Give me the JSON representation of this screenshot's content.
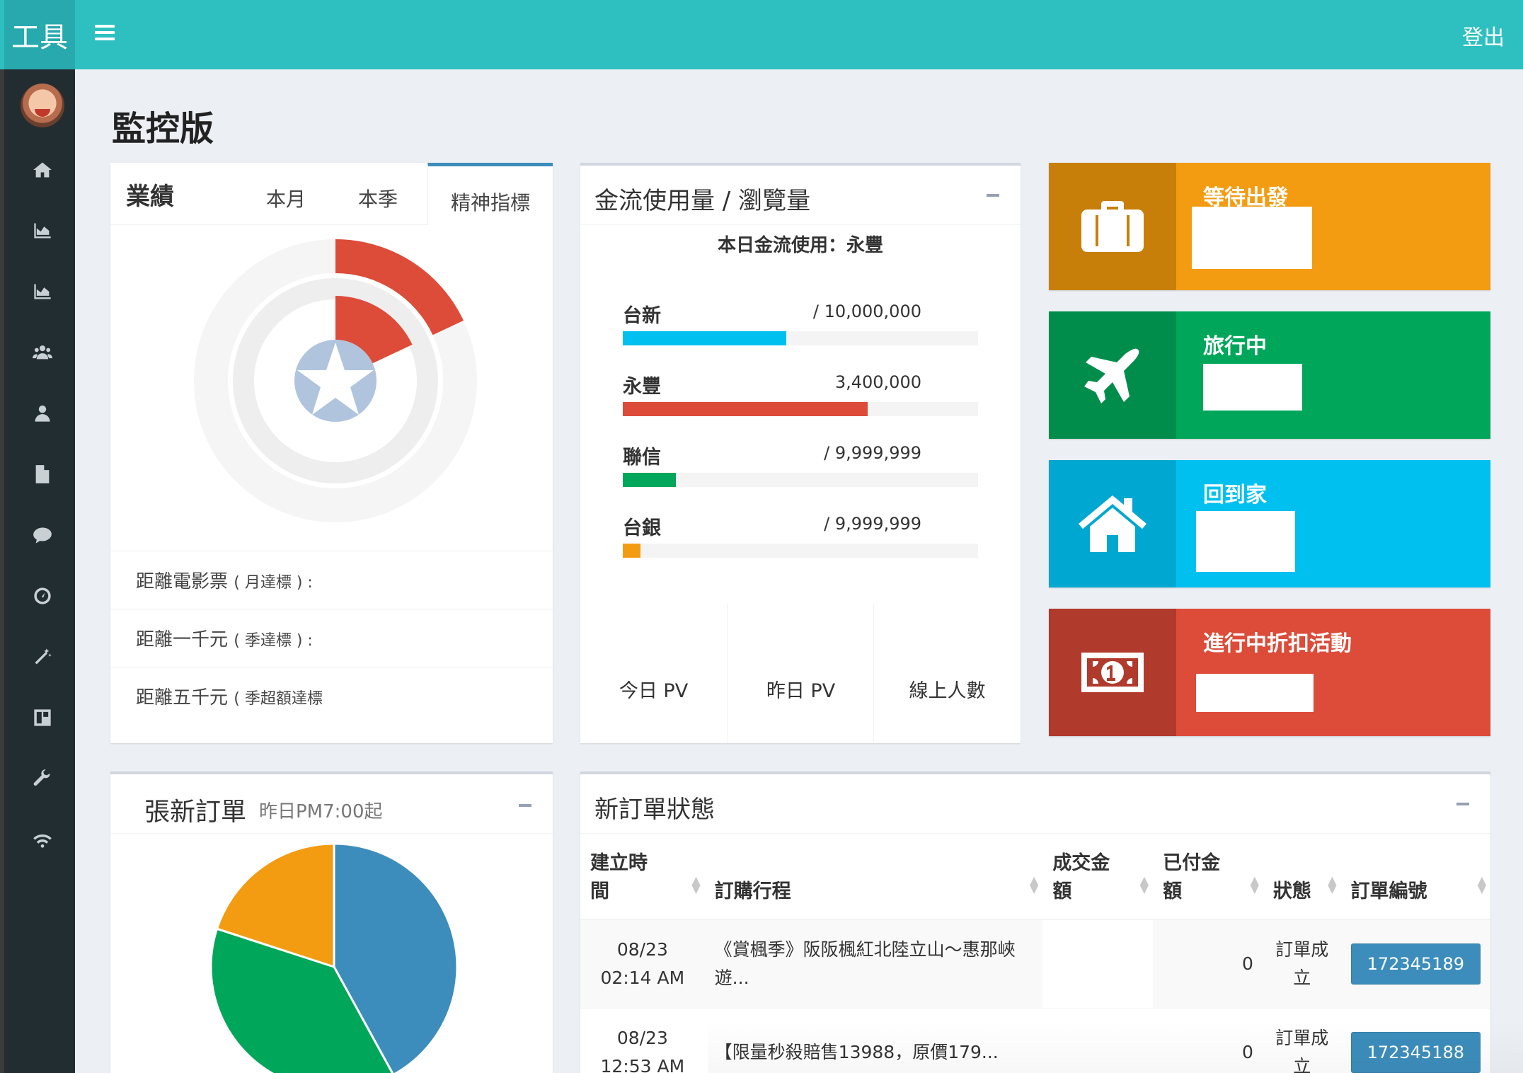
{
  "app": {
    "logo": "工具",
    "logout": "登出"
  },
  "page": {
    "title": "監控版"
  },
  "performance": {
    "title": "業績",
    "tabs": [
      "本月",
      "本季",
      "精神指標"
    ],
    "active_tab": "精神指標",
    "colors": {
      "ring": "#dd4b39",
      "track": "#eeeeee",
      "star": "#b0c4de"
    },
    "progress": {
      "outer": 0.18,
      "inner": 0.18
    },
    "rows": [
      {
        "label": "距離電影票",
        "note": "( 月達標 ) :"
      },
      {
        "label": "距離一千元",
        "note": "( 季達標 ) :"
      },
      {
        "label": "距離五千元",
        "note": "( 季超額達標"
      }
    ]
  },
  "payment": {
    "title": "金流使用量 / 瀏覽量",
    "subtitle": "本日金流使用：永豐",
    "bars": [
      {
        "name": "台新",
        "amount": "/ 10,000,000",
        "fraction": 0.46,
        "color": "#00c0ef"
      },
      {
        "name": "永豐",
        "amount": "3,400,000",
        "fraction": 0.69,
        "color": "#dd4b39"
      },
      {
        "name": "聯信",
        "amount": "/ 9,999,999",
        "fraction": 0.15,
        "color": "#00a65a"
      },
      {
        "name": "台銀",
        "amount": "/ 9,999,999",
        "fraction": 0.05,
        "color": "#f39c12"
      }
    ],
    "stats": [
      "今日 PV",
      "昨日 PV",
      "線上人數"
    ]
  },
  "info_boxes": [
    {
      "label": "等待出發",
      "icon": "suitcase-icon",
      "bg": "#f39c12",
      "icon_bg": "#c87f0a"
    },
    {
      "label": "旅行中",
      "icon": "plane-icon",
      "bg": "#00a65a",
      "icon_bg": "#008d4c"
    },
    {
      "label": "回到家",
      "icon": "home-icon",
      "bg": "#00c0ef",
      "icon_bg": "#00a7d0"
    },
    {
      "label": "進行中折扣活動",
      "icon": "money-icon",
      "bg": "#dd4b39",
      "icon_bg": "#b03a2c"
    }
  ],
  "orders": {
    "title": "張新訂單",
    "subtitle": "昨日PM7:00起",
    "pie": [
      {
        "name": "blue",
        "value": 42,
        "color": "#3c8dbc"
      },
      {
        "name": "green",
        "value": 38,
        "color": "#00a65a"
      },
      {
        "name": "orange",
        "value": 20,
        "color": "#f39c12"
      }
    ]
  },
  "status": {
    "title": "新訂單狀態",
    "columns": [
      "建立時間",
      "訂購行程",
      "成交金額",
      "已付金額",
      "狀態",
      "訂單編號"
    ],
    "rows": [
      {
        "created": "08/23 02:14 AM",
        "trip": "《賞楓季》阪阪楓紅北陸立山～惠那峽遊...",
        "deal": "",
        "paid": "0",
        "state": "訂單成立",
        "order_no": "172345189"
      },
      {
        "created": "08/23 12:53 AM",
        "trip": "【限量秒殺賠售13988，原價179...",
        "deal": "",
        "paid": "0",
        "state": "訂單成立",
        "order_no": "172345188"
      }
    ]
  },
  "sidebar": {
    "icons": [
      "home-icon",
      "area-chart-icon",
      "area-chart-icon",
      "users-icon",
      "user-icon",
      "file-icon",
      "comment-icon",
      "dashboard-icon",
      "magic-icon",
      "table-icon",
      "wrench-icon",
      "wifi-icon"
    ]
  }
}
